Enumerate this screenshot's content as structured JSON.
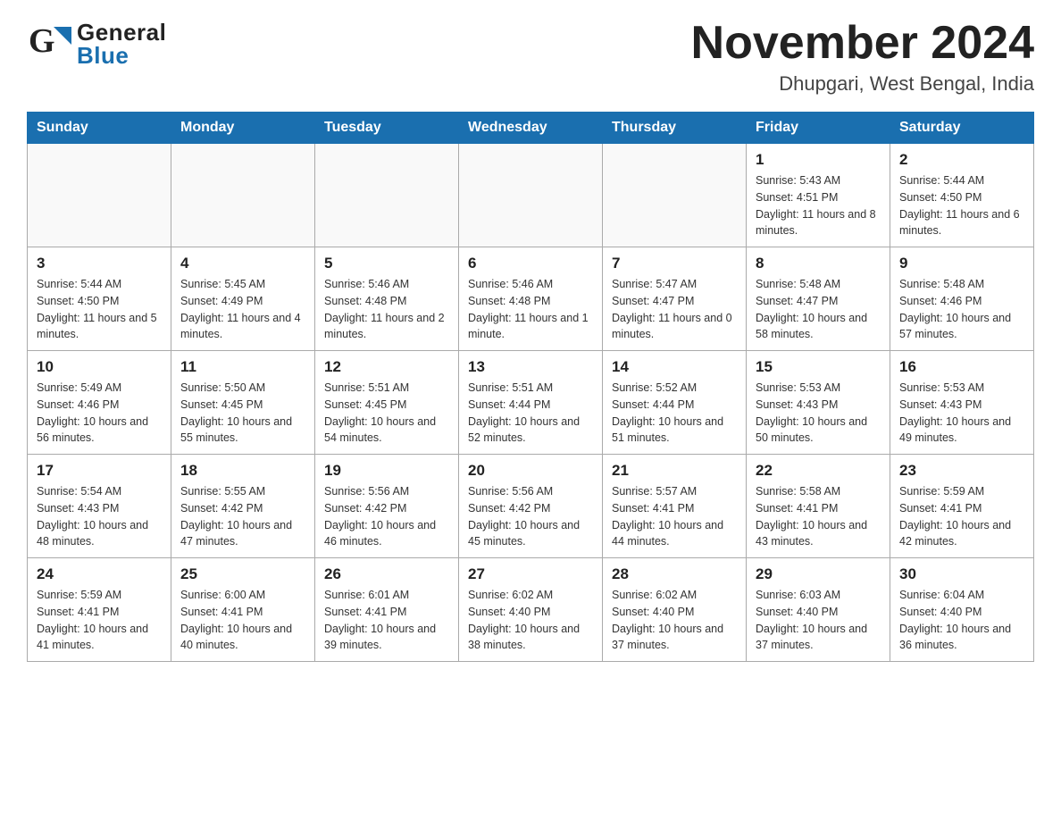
{
  "header": {
    "title": "November 2024",
    "subtitle": "Dhupgari, West Bengal, India",
    "logo_general": "General",
    "logo_blue": "Blue"
  },
  "days_of_week": [
    "Sunday",
    "Monday",
    "Tuesday",
    "Wednesday",
    "Thursday",
    "Friday",
    "Saturday"
  ],
  "weeks": [
    [
      {
        "day": "",
        "info": ""
      },
      {
        "day": "",
        "info": ""
      },
      {
        "day": "",
        "info": ""
      },
      {
        "day": "",
        "info": ""
      },
      {
        "day": "",
        "info": ""
      },
      {
        "day": "1",
        "info": "Sunrise: 5:43 AM\nSunset: 4:51 PM\nDaylight: 11 hours and 8 minutes."
      },
      {
        "day": "2",
        "info": "Sunrise: 5:44 AM\nSunset: 4:50 PM\nDaylight: 11 hours and 6 minutes."
      }
    ],
    [
      {
        "day": "3",
        "info": "Sunrise: 5:44 AM\nSunset: 4:50 PM\nDaylight: 11 hours and 5 minutes."
      },
      {
        "day": "4",
        "info": "Sunrise: 5:45 AM\nSunset: 4:49 PM\nDaylight: 11 hours and 4 minutes."
      },
      {
        "day": "5",
        "info": "Sunrise: 5:46 AM\nSunset: 4:48 PM\nDaylight: 11 hours and 2 minutes."
      },
      {
        "day": "6",
        "info": "Sunrise: 5:46 AM\nSunset: 4:48 PM\nDaylight: 11 hours and 1 minute."
      },
      {
        "day": "7",
        "info": "Sunrise: 5:47 AM\nSunset: 4:47 PM\nDaylight: 11 hours and 0 minutes."
      },
      {
        "day": "8",
        "info": "Sunrise: 5:48 AM\nSunset: 4:47 PM\nDaylight: 10 hours and 58 minutes."
      },
      {
        "day": "9",
        "info": "Sunrise: 5:48 AM\nSunset: 4:46 PM\nDaylight: 10 hours and 57 minutes."
      }
    ],
    [
      {
        "day": "10",
        "info": "Sunrise: 5:49 AM\nSunset: 4:46 PM\nDaylight: 10 hours and 56 minutes."
      },
      {
        "day": "11",
        "info": "Sunrise: 5:50 AM\nSunset: 4:45 PM\nDaylight: 10 hours and 55 minutes."
      },
      {
        "day": "12",
        "info": "Sunrise: 5:51 AM\nSunset: 4:45 PM\nDaylight: 10 hours and 54 minutes."
      },
      {
        "day": "13",
        "info": "Sunrise: 5:51 AM\nSunset: 4:44 PM\nDaylight: 10 hours and 52 minutes."
      },
      {
        "day": "14",
        "info": "Sunrise: 5:52 AM\nSunset: 4:44 PM\nDaylight: 10 hours and 51 minutes."
      },
      {
        "day": "15",
        "info": "Sunrise: 5:53 AM\nSunset: 4:43 PM\nDaylight: 10 hours and 50 minutes."
      },
      {
        "day": "16",
        "info": "Sunrise: 5:53 AM\nSunset: 4:43 PM\nDaylight: 10 hours and 49 minutes."
      }
    ],
    [
      {
        "day": "17",
        "info": "Sunrise: 5:54 AM\nSunset: 4:43 PM\nDaylight: 10 hours and 48 minutes."
      },
      {
        "day": "18",
        "info": "Sunrise: 5:55 AM\nSunset: 4:42 PM\nDaylight: 10 hours and 47 minutes."
      },
      {
        "day": "19",
        "info": "Sunrise: 5:56 AM\nSunset: 4:42 PM\nDaylight: 10 hours and 46 minutes."
      },
      {
        "day": "20",
        "info": "Sunrise: 5:56 AM\nSunset: 4:42 PM\nDaylight: 10 hours and 45 minutes."
      },
      {
        "day": "21",
        "info": "Sunrise: 5:57 AM\nSunset: 4:41 PM\nDaylight: 10 hours and 44 minutes."
      },
      {
        "day": "22",
        "info": "Sunrise: 5:58 AM\nSunset: 4:41 PM\nDaylight: 10 hours and 43 minutes."
      },
      {
        "day": "23",
        "info": "Sunrise: 5:59 AM\nSunset: 4:41 PM\nDaylight: 10 hours and 42 minutes."
      }
    ],
    [
      {
        "day": "24",
        "info": "Sunrise: 5:59 AM\nSunset: 4:41 PM\nDaylight: 10 hours and 41 minutes."
      },
      {
        "day": "25",
        "info": "Sunrise: 6:00 AM\nSunset: 4:41 PM\nDaylight: 10 hours and 40 minutes."
      },
      {
        "day": "26",
        "info": "Sunrise: 6:01 AM\nSunset: 4:41 PM\nDaylight: 10 hours and 39 minutes."
      },
      {
        "day": "27",
        "info": "Sunrise: 6:02 AM\nSunset: 4:40 PM\nDaylight: 10 hours and 38 minutes."
      },
      {
        "day": "28",
        "info": "Sunrise: 6:02 AM\nSunset: 4:40 PM\nDaylight: 10 hours and 37 minutes."
      },
      {
        "day": "29",
        "info": "Sunrise: 6:03 AM\nSunset: 4:40 PM\nDaylight: 10 hours and 37 minutes."
      },
      {
        "day": "30",
        "info": "Sunrise: 6:04 AM\nSunset: 4:40 PM\nDaylight: 10 hours and 36 minutes."
      }
    ]
  ]
}
